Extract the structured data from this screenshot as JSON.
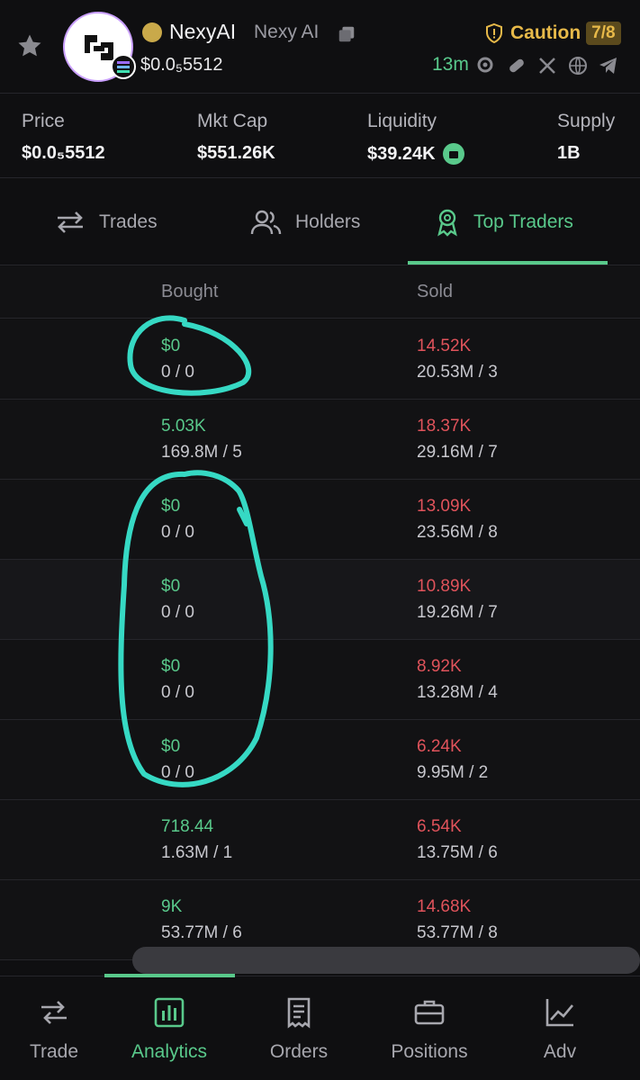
{
  "token": {
    "symbol": "NexyAI",
    "name": "Nexy AI",
    "price": "$0.0₅5512",
    "risk_label": "Caution",
    "risk_score": "7/8",
    "age": "13m"
  },
  "stats": [
    {
      "label": "Price",
      "value": "$0.0₅5512"
    },
    {
      "label": "Mkt Cap",
      "value": "$551.26K"
    },
    {
      "label": "Liquidity",
      "value": "$39.24K"
    },
    {
      "label": "Supply",
      "value": "1B"
    }
  ],
  "tabs": [
    {
      "label": "Trades"
    },
    {
      "label": "Holders"
    },
    {
      "label": "Top Traders"
    }
  ],
  "table": {
    "headers": {
      "bought": "Bought",
      "sold": "Sold"
    },
    "rows": [
      {
        "bought": "$0",
        "bought_sub": "0 / 0",
        "sold": "14.52K",
        "sold_sub": "20.53M / 3"
      },
      {
        "bought": "5.03K",
        "bought_sub": "169.8M / 5",
        "sold": "18.37K",
        "sold_sub": "29.16M / 7"
      },
      {
        "bought": "$0",
        "bought_sub": "0 / 0",
        "sold": "13.09K",
        "sold_sub": "23.56M / 8"
      },
      {
        "bought": "$0",
        "bought_sub": "0 / 0",
        "sold": "10.89K",
        "sold_sub": "19.26M / 7"
      },
      {
        "bought": "$0",
        "bought_sub": "0 / 0",
        "sold": "8.92K",
        "sold_sub": "13.28M / 4"
      },
      {
        "bought": "$0",
        "bought_sub": "0 / 0",
        "sold": "6.24K",
        "sold_sub": "9.95M / 2"
      },
      {
        "bought": "718.44",
        "bought_sub": "1.63M / 1",
        "sold": "6.54K",
        "sold_sub": "13.75M / 6"
      },
      {
        "bought": "9K",
        "bought_sub": "53.77M / 6",
        "sold": "14.68K",
        "sold_sub": "53.77M / 8"
      }
    ]
  },
  "nav": [
    {
      "label": "Trade"
    },
    {
      "label": "Analytics"
    },
    {
      "label": "Orders"
    },
    {
      "label": "Positions"
    },
    {
      "label": "Adv"
    }
  ],
  "colors": {
    "accent": "#59c98b",
    "sell": "#e0535b",
    "caution": "#e7b949",
    "annotation": "#36d9c4"
  },
  "icons": [
    "star-icon",
    "token-logo",
    "solana-icon",
    "pill-icon",
    "copy-icon",
    "shield-icon",
    "search-icon",
    "pill-link-icon",
    "x-icon",
    "globe-icon",
    "telegram-icon",
    "lock-icon",
    "swap-icon",
    "users-icon",
    "award-icon",
    "bar-chart-icon",
    "receipt-icon",
    "briefcase-icon",
    "trend-icon"
  ]
}
